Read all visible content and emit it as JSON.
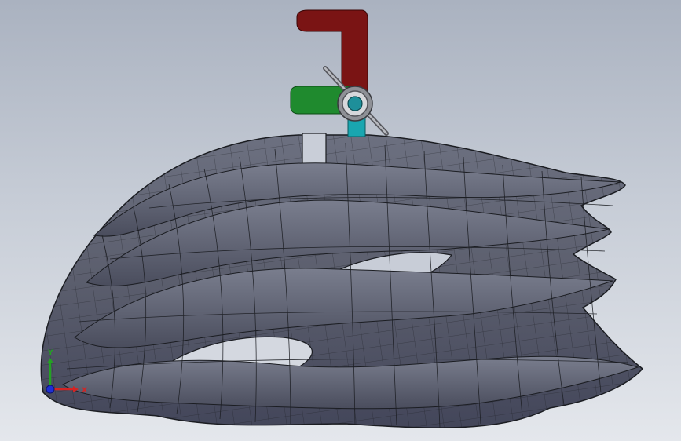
{
  "viewport": {
    "model": "bicycle helmet",
    "mesh_edge_color": "#1b1d22",
    "surface_color": "#5b5e6d",
    "surface_shadow_color": "#3f4250",
    "background_top": "#aab2c0",
    "background_bottom": "#e4e7ec"
  },
  "triad": {
    "colors": {
      "x": "#d42424",
      "y": "#23a323",
      "z": "#1f2fd4"
    }
  },
  "move_triad": {
    "handle_x_color": "#7a1414",
    "handle_y_color": "#1f8a2e",
    "handle_z_color": "#19a6b0",
    "icons": [
      "rotate-handle-icon",
      "drag-ring-icon"
    ]
  },
  "axis_labels": {
    "x": "X",
    "y": "Y"
  }
}
